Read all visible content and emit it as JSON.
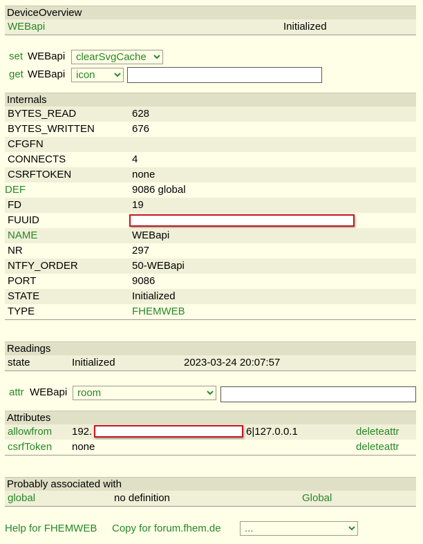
{
  "device_overview": {
    "title": "DeviceOverview",
    "device_name": "WEBapi",
    "state": "Initialized"
  },
  "commands": {
    "set_label": "set",
    "set_device": "WEBapi",
    "set_selected": "clearSvgCache",
    "get_label": "get",
    "get_device": "WEBapi",
    "get_selected": "icon",
    "get_value": ""
  },
  "internals": {
    "title": "Internals",
    "rows": [
      {
        "name": "BYTES_READ",
        "value": "628"
      },
      {
        "name": "BYTES_WRITTEN",
        "value": "676"
      },
      {
        "name": "CFGFN",
        "value": ""
      },
      {
        "name": "CONNECTS",
        "value": "4"
      },
      {
        "name": "CSRFTOKEN",
        "value": "none"
      },
      {
        "name": "DEF",
        "value": "9086 global"
      },
      {
        "name": "FD",
        "value": "19"
      },
      {
        "name": "FUUID",
        "value": ""
      },
      {
        "name": "NAME",
        "value": "WEBapi"
      },
      {
        "name": "NR",
        "value": "297"
      },
      {
        "name": "NTFY_ORDER",
        "value": "50-WEBapi"
      },
      {
        "name": "PORT",
        "value": "9086"
      },
      {
        "name": "STATE",
        "value": "Initialized"
      },
      {
        "name": "TYPE",
        "value": "FHEMWEB"
      }
    ]
  },
  "readings": {
    "title": "Readings",
    "rows": [
      {
        "name": "state",
        "value": "Initialized",
        "timestamp": "2023-03-24 20:07:57"
      }
    ]
  },
  "attr_cmd": {
    "label": "attr",
    "device": "WEBapi",
    "selected": "room",
    "value": ""
  },
  "attributes": {
    "title": "Attributes",
    "rows": [
      {
        "name": "allowfrom",
        "value_start": "192.",
        "value_end": "6|127.0.0.1",
        "action": "deleteattr"
      },
      {
        "name": "csrfToken",
        "value": "none",
        "action": "deleteattr"
      }
    ]
  },
  "associated": {
    "title": "Probably associated with",
    "rows": [
      {
        "name": "global",
        "value": "no definition",
        "type": "Global"
      }
    ]
  },
  "footer": {
    "help": "Help for FHEMWEB",
    "copy": "Copy for forum.fhem.de",
    "select_value": "..."
  },
  "colors": {
    "background": "#FFFFE7",
    "header_bg": "#E0E0C7",
    "row_alt": "#F0F0D8",
    "link": "#278727",
    "redaction": "#C8141E"
  }
}
